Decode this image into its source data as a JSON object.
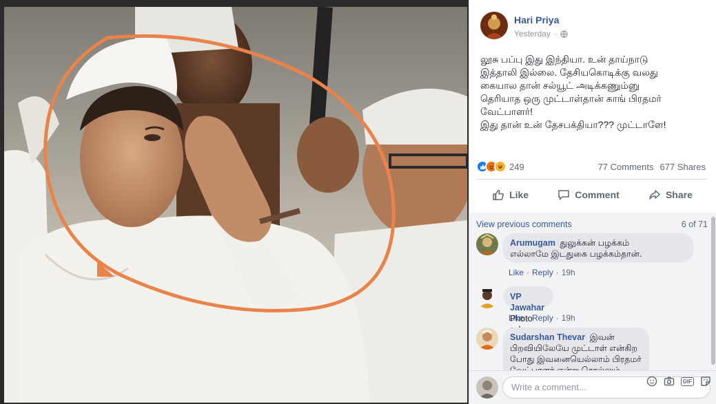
{
  "post": {
    "author": "Hari Priya",
    "time": "Yesterday",
    "text_lines": [
      "லூசு பப்பு இது இந்தியா. உன் தாய்நாடு",
      "இத்தாலி இல்லை. தேசியகொடிக்கு வலது",
      "கையால தான் சல்யூட் அடிக்கணும்னு",
      "தெரியாத ஒரு முட்டாள்தான் காங் பிரதமர்",
      "வேட்பாளர்!",
      "இது தான் உன் தேசபக்தியா??? முட்டாளே!"
    ],
    "reaction_count": "249",
    "comments_count": "77 Comments",
    "shares_count": "677 Shares"
  },
  "actions": {
    "like": "Like",
    "comment": "Comment",
    "share": "Share"
  },
  "comments_section": {
    "view_previous": "View previous comments",
    "position": "6 of 71",
    "items": [
      {
        "name": "Arumugam",
        "text_line1": "துலுக்கன் பழக்கம்",
        "text_line2": "எல்லாமே இடதுகை பழக்கம்தான்.",
        "like": "Like",
        "reply": "Reply",
        "time": "19h"
      },
      {
        "name": "VP Jawahar",
        "text_line1": "Photo svhop work",
        "like": "Like",
        "reply": "Reply",
        "time": "19h"
      },
      {
        "name": "Sudarshan Thevar",
        "text_line1": "இவன்",
        "text_line2": "பிறவியிலேயே முட்டாள் என்கிற",
        "text_line3": "போது இவனையெல்லாம் பிரதமர்",
        "text_line4": "வேட்பாளர் என்று சொல்லும்"
      }
    ]
  },
  "composer": {
    "placeholder": "Write a comment...",
    "gif": "GIF"
  },
  "colors": {
    "link": "#385898",
    "annotation_circle": "#e8834a",
    "comments_bg": "#f2f3f5"
  }
}
